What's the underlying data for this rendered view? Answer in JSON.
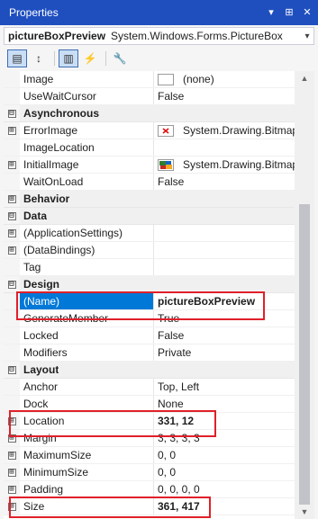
{
  "window": {
    "title": "Properties",
    "dropdown_glyph": "▾",
    "pin_glyph": "⊞",
    "close_glyph": "✕"
  },
  "object_selector": {
    "name": "pictureBoxPreview",
    "type": "System.Windows.Forms.PictureBox",
    "dropdown_glyph": "▾"
  },
  "toolbar": {
    "buttons": [
      {
        "icon": "categorized-icon",
        "glyph": "▤",
        "active": true
      },
      {
        "icon": "alphabetical-icon",
        "glyph": "↕",
        "active": false
      },
      {
        "icon": "properties-icon",
        "glyph": "▥",
        "active": true
      },
      {
        "icon": "events-icon",
        "glyph": "⚡",
        "active": false
      },
      {
        "icon": "property-pages-icon",
        "glyph": "🔧",
        "active": false
      }
    ]
  },
  "grid": {
    "rows": [
      {
        "kind": "prop",
        "name": "Image",
        "value": "(none)",
        "swatch": "empty"
      },
      {
        "kind": "prop",
        "name": "UseWaitCursor",
        "value": "False"
      },
      {
        "kind": "cat",
        "name": "Asynchronous",
        "glyph": "⊟"
      },
      {
        "kind": "prop",
        "name": "ErrorImage",
        "value": "System.Drawing.Bitmap",
        "swatch": "error",
        "expander": "⊞"
      },
      {
        "kind": "prop",
        "name": "ImageLocation",
        "value": ""
      },
      {
        "kind": "prop",
        "name": "InitialImage",
        "value": "System.Drawing.Bitmap",
        "swatch": "image",
        "expander": "⊞"
      },
      {
        "kind": "prop",
        "name": "WaitOnLoad",
        "value": "False"
      },
      {
        "kind": "cat",
        "name": "Behavior",
        "glyph": "⊞"
      },
      {
        "kind": "cat",
        "name": "Data",
        "glyph": "⊟"
      },
      {
        "kind": "prop",
        "name": "(ApplicationSettings)",
        "value": "",
        "expander": "⊞"
      },
      {
        "kind": "prop",
        "name": "(DataBindings)",
        "value": "",
        "expander": "⊞"
      },
      {
        "kind": "prop",
        "name": "Tag",
        "value": ""
      },
      {
        "kind": "cat",
        "name": "Design",
        "glyph": "⊟"
      },
      {
        "kind": "prop",
        "name": "(Name)",
        "value": "pictureBoxPreview",
        "selected": true
      },
      {
        "kind": "prop",
        "name": "GenerateMember",
        "value": "True"
      },
      {
        "kind": "prop",
        "name": "Locked",
        "value": "False"
      },
      {
        "kind": "prop",
        "name": "Modifiers",
        "value": "Private"
      },
      {
        "kind": "cat",
        "name": "Layout",
        "glyph": "⊟"
      },
      {
        "kind": "prop",
        "name": "Anchor",
        "value": "Top, Left"
      },
      {
        "kind": "prop",
        "name": "Dock",
        "value": "None"
      },
      {
        "kind": "prop",
        "name": "Location",
        "value": "331, 12",
        "bold": true,
        "expander": "⊞"
      },
      {
        "kind": "prop",
        "name": "Margin",
        "value": "3, 3, 3, 3",
        "expander": "⊞"
      },
      {
        "kind": "prop",
        "name": "MaximumSize",
        "value": "0, 0",
        "expander": "⊞"
      },
      {
        "kind": "prop",
        "name": "MinimumSize",
        "value": "0, 0",
        "expander": "⊞"
      },
      {
        "kind": "prop",
        "name": "Padding",
        "value": "0, 0, 0, 0",
        "expander": "⊞"
      },
      {
        "kind": "prop",
        "name": "Size",
        "value": "361, 417",
        "bold": true,
        "expander": "⊞"
      }
    ]
  },
  "scrollbar": {
    "up_glyph": "▲",
    "down_glyph": "▼"
  },
  "colors": {
    "titlebar": "#1f4fbf",
    "selection": "#0078d7",
    "highlight_outline": "#e0202a"
  }
}
